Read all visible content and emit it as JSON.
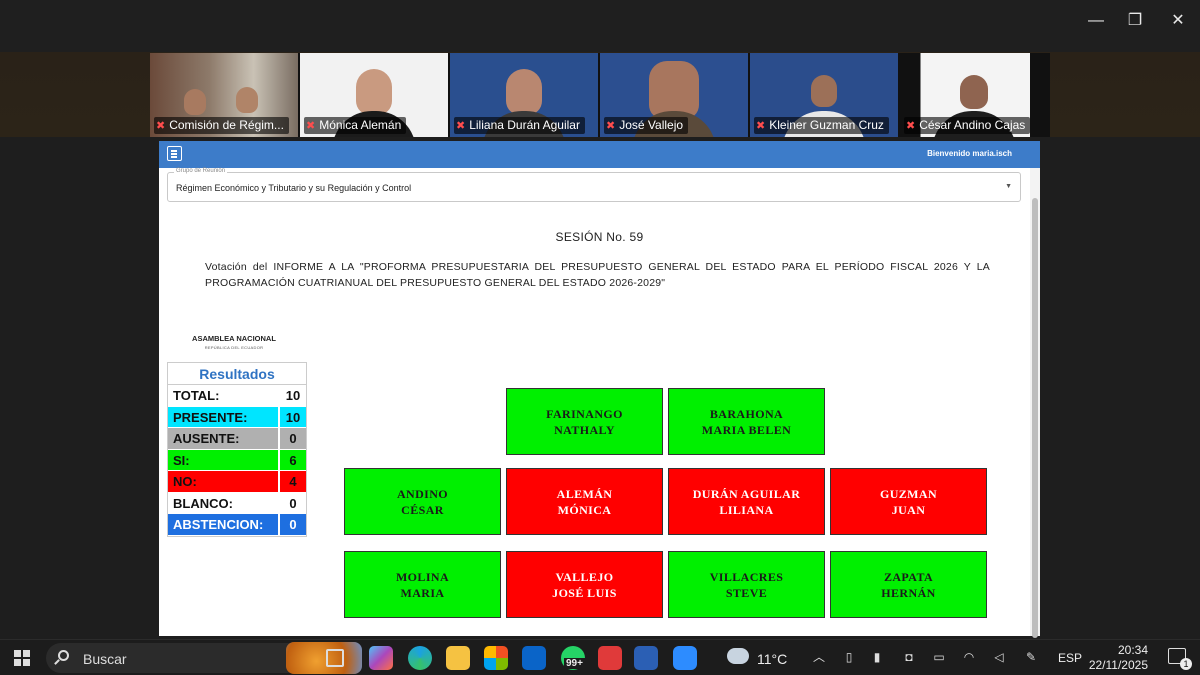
{
  "window": {
    "minimize": "—",
    "maximize": "❐",
    "close": "✕"
  },
  "participants": [
    {
      "name": "Comisión de Régim..."
    },
    {
      "name": "Mónica Alemán"
    },
    {
      "name": "Liliana Durán Aguilar"
    },
    {
      "name": "José Vallejo"
    },
    {
      "name": "Kleiner Guzman Cruz"
    },
    {
      "name": "César Andino Cajas"
    }
  ],
  "app": {
    "welcome": "Bienvenido maria.isch",
    "group_label": "Grupo de Reunión",
    "group_value": "Régimen Económico y Tributario y su Regulación y Control",
    "session": "SESIÓN No. 59",
    "vote_title": "Votación del INFORME A LA \"PROFORMA PRESUPUESTARIA DEL PRESUPUESTO GENERAL DEL ESTADO PARA EL PERÍODO FISCAL 2026 Y LA PROGRAMACIÓN CUATRIANUAL DEL PRESUPUESTO GENERAL DEL ESTADO 2026-2029\"",
    "org_name": "ASAMBLEA NACIONAL",
    "org_sub": "REPÚBLICA DEL ECUADOR"
  },
  "results": {
    "title": "Resultados",
    "rows": [
      {
        "label": "TOTAL:",
        "value": "10",
        "color": "#ffffff"
      },
      {
        "label": "PRESENTE:",
        "value": "10",
        "color": "#00e5ff"
      },
      {
        "label": "AUSENTE:",
        "value": "0",
        "color": "#b0b0b0"
      },
      {
        "label": "SI:",
        "value": "6",
        "color": "#00f000"
      },
      {
        "label": "NO:",
        "value": "4",
        "color": "#ff0000"
      },
      {
        "label": "BLANCO:",
        "value": "0",
        "color": "#ffffff"
      },
      {
        "label": "ABSTENCION:",
        "value": "0",
        "color": "#1e6fe0"
      }
    ]
  },
  "members": [
    {
      "line1": "FARINANGO",
      "line2": "NATHALY",
      "vote": "green"
    },
    {
      "line1": "BARAHONA",
      "line2": "MARIA BELEN",
      "vote": "green"
    },
    {
      "line1": "ANDINO",
      "line2": "CÉSAR",
      "vote": "green"
    },
    {
      "line1": "ALEMÁN",
      "line2": "MÓNICA",
      "vote": "red"
    },
    {
      "line1": "DURÁN AGUILAR",
      "line2": "LILIANA",
      "vote": "red"
    },
    {
      "line1": "GUZMAN",
      "line2": "JUAN",
      "vote": "red"
    },
    {
      "line1": "MOLINA",
      "line2": "MARIA",
      "vote": "green"
    },
    {
      "line1": "VALLEJO",
      "line2": "JOSÉ LUIS",
      "vote": "red"
    },
    {
      "line1": "VILLACRES",
      "line2": "STEVE",
      "vote": "green"
    },
    {
      "line1": "ZAPATA",
      "line2": "HERNÁN",
      "vote": "green"
    }
  ],
  "taskbar": {
    "search": "Buscar",
    "temperature": "11°C",
    "language": "ESP",
    "time": "20:34",
    "date": "22/11/2025",
    "badge_99": "99+",
    "notifications": "1"
  }
}
